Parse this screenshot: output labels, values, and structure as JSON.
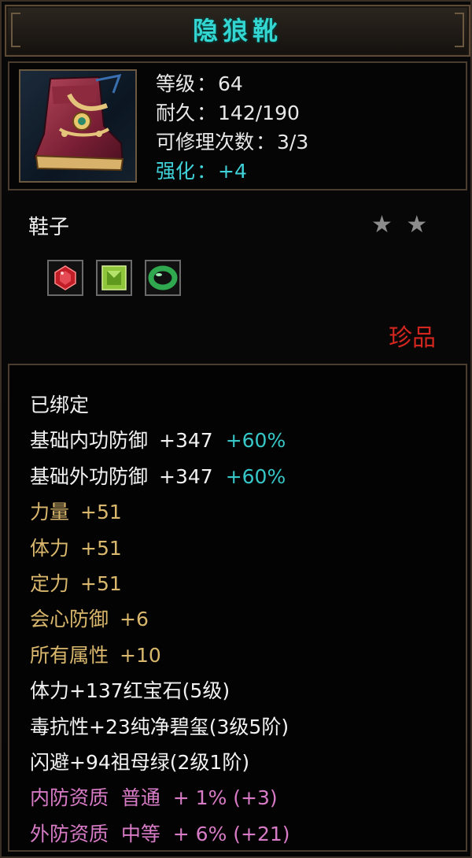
{
  "item": {
    "name": "隐狼靴",
    "icon": "boots-icon",
    "stats": {
      "level_label": "等级",
      "level_value": "64",
      "durability_label": "耐久",
      "durability_value": "142/190",
      "repair_label": "可修理次数",
      "repair_value": "3/3",
      "enhance_label": "强化",
      "enhance_value": "+4"
    },
    "separator": "：",
    "type": "鞋子",
    "stars": "★ ★",
    "gems": [
      "red-gem-icon",
      "green-gem-icon",
      "jade-ring-icon"
    ],
    "rarity": "珍品"
  },
  "attributes": {
    "bound": "已绑定",
    "inner_def_label": "基础内功防御",
    "inner_def_value": "+347",
    "inner_def_pct": "+60%",
    "outer_def_label": "基础外功防御",
    "outer_def_value": "+347",
    "outer_def_pct": "+60%",
    "strength_label": "力量",
    "strength_value": "+51",
    "stamina_label": "体力",
    "stamina_value": "+51",
    "focus_label": "定力",
    "focus_value": "+51",
    "crit_def_label": "会心防御",
    "crit_def_value": "+6",
    "all_attr_label": "所有属性",
    "all_attr_value": "+10",
    "gem1": "体力+137红宝石(5级)",
    "gem2": "毒抗性+23纯净碧玺(3级5阶)",
    "gem3": "闪避+94祖母绿(2级1阶)",
    "inner_quality": "内防资质  普通  + 1% (+3)",
    "outer_quality": "外防资质  中等  + 6% (+21)"
  },
  "colors": {
    "title": "#33d6d0",
    "enhance": "#3fd2d9",
    "percent": "#37c7c8",
    "attr_gold": "#d9b76c",
    "quality_pink": "#d87bc6",
    "rarity_red": "#d2261f"
  }
}
